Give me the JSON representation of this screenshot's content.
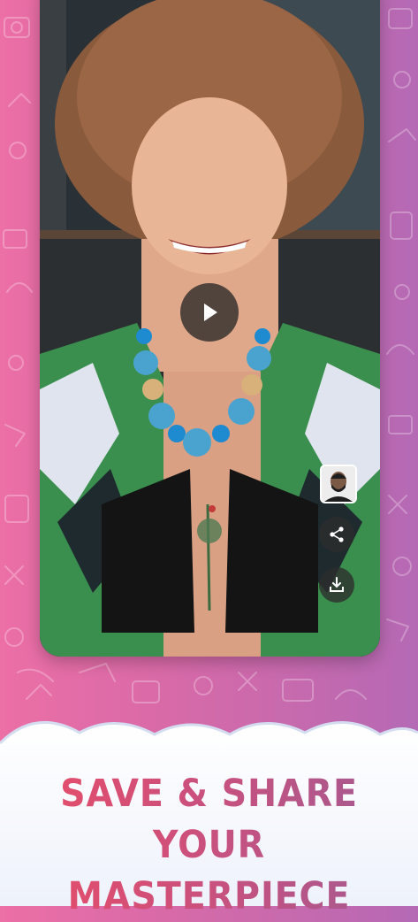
{
  "headline": {
    "line1": "SAVE & SHARE YOUR",
    "line2": "MASTERPIECE"
  },
  "icons": {
    "play": "play-icon",
    "share": "share-icon",
    "download": "download-icon",
    "avatar": "face-avatar"
  },
  "colors": {
    "background_left": "#ec6fa6",
    "background_right": "#b569b4",
    "headline_start": "#e84c68",
    "headline_end": "#a35a92",
    "button_bg": "#2d2d2d"
  }
}
